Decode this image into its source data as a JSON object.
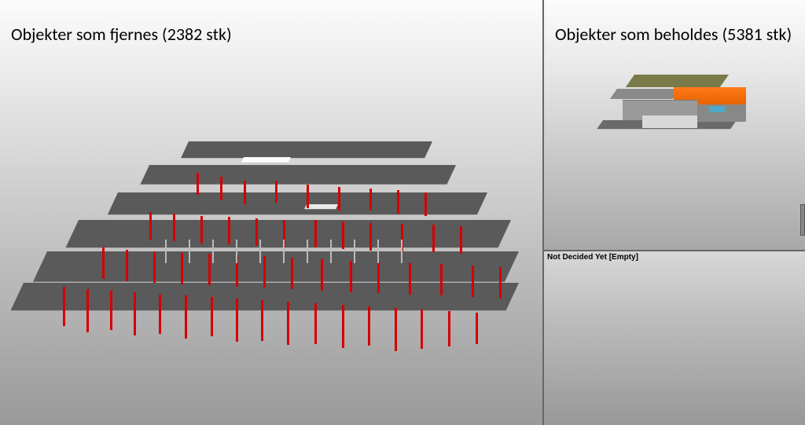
{
  "viewports": {
    "left": {
      "title": "Objekter som fjernes (2382 stk)"
    },
    "right_top": {
      "title": "Objekter som beholdes (5381 stk)"
    },
    "right_bottom": {
      "status": "Not Decided Yet [Empty]"
    }
  }
}
